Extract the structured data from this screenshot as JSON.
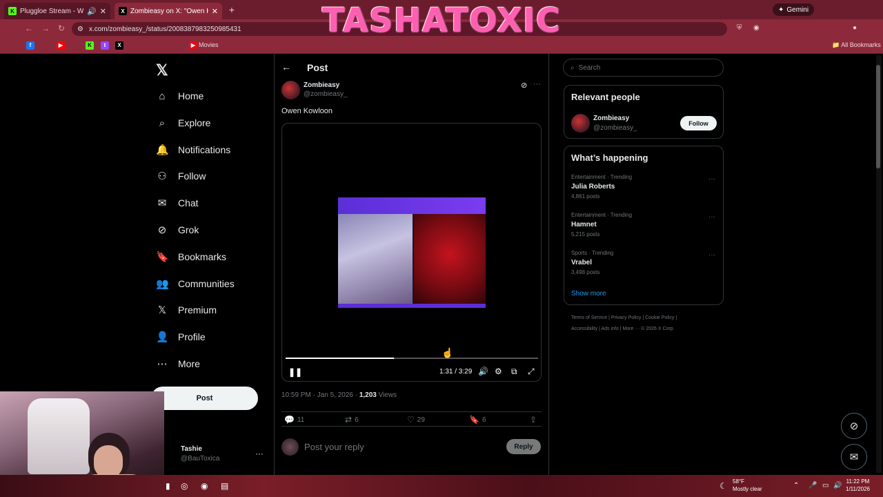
{
  "browser": {
    "tabs": [
      {
        "title": "Pluggloe Stream - Watch Li",
        "icon": "kick-icon"
      },
      {
        "title": "Zombieasy on X: \"Owen Ko",
        "icon": "x-icon"
      }
    ],
    "gemini_label": "Gemini",
    "url": "x.com/zombieasy_/status/2008387983250985431",
    "bookmarks_folder": "All Bookmarks",
    "bookmark_movies": "Movies"
  },
  "overlay": {
    "brand_title": "TASHATOXIC"
  },
  "sidebar": {
    "items": [
      {
        "label": "Home",
        "icon": "home-icon"
      },
      {
        "label": "Explore",
        "icon": "search-icon"
      },
      {
        "label": "Notifications",
        "icon": "bell-icon"
      },
      {
        "label": "Follow",
        "icon": "add-user-icon"
      },
      {
        "label": "Chat",
        "icon": "mail-icon"
      },
      {
        "label": "Grok",
        "icon": "grok-icon"
      },
      {
        "label": "Bookmarks",
        "icon": "bookmark-icon"
      },
      {
        "label": "Communities",
        "icon": "people-icon"
      },
      {
        "label": "Premium",
        "icon": "x-icon"
      },
      {
        "label": "Profile",
        "icon": "person-icon"
      },
      {
        "label": "More",
        "icon": "more-circle-icon"
      }
    ],
    "post_button": "Post",
    "account": {
      "name": "Tashie",
      "handle": "@BauToxica"
    }
  },
  "post": {
    "header_title": "Post",
    "author_name": "Zombieasy",
    "author_handle": "@zombieasy_",
    "text": "Owen Kowloon",
    "video": {
      "time": "1:31 / 3:29",
      "progress": 0.43
    },
    "timestamp": "10:59 PM · Jan 5, 2026 · ",
    "views_count": "1,203",
    "views_label": " Views",
    "stats": {
      "replies": "11",
      "reposts": "6",
      "likes": "29",
      "bookmarks": "6"
    },
    "reply_placeholder": "Post your reply",
    "reply_button": "Reply"
  },
  "right": {
    "search_placeholder": "Search",
    "relevant_title": "Relevant people",
    "relevant_person": {
      "name": "Zombieasy",
      "handle": "@zombieasy_",
      "button": "Follow"
    },
    "happening_title": "What’s happening",
    "trends": [
      {
        "category": "Entertainment · Trending",
        "name": "Julia Roberts",
        "count": "4,861 posts"
      },
      {
        "category": "Entertainment · Trending",
        "name": "Hamnet",
        "count": "5,215 posts"
      },
      {
        "category": "Sports · Trending",
        "name": "Vrabel",
        "count": "3,498 posts"
      }
    ],
    "show_more": "Show more",
    "footer_line1": "Terms of Service  |  Privacy Policy  |  Cookie Policy  |",
    "footer_line2": "Accessibility  |  Ads info  |  More ···  © 2026 X Corp."
  },
  "taskbar": {
    "weather_temp": "58°F",
    "weather_desc": "Mostly clear",
    "time": "11:22 PM",
    "date": "1/11/2026"
  }
}
